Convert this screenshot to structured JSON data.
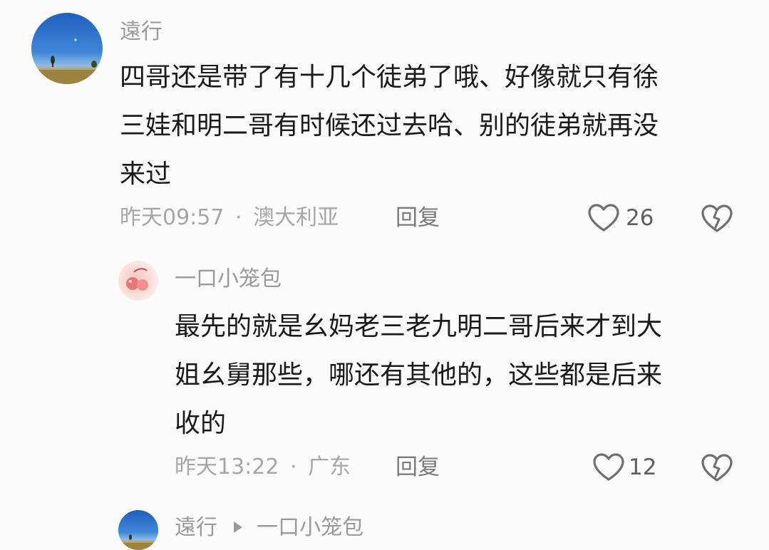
{
  "comments": [
    {
      "username": "遠行",
      "lines": [
        "四哥还是带了有十几个徒弟了哦、好像就只有徐",
        "三娃和明二哥有时候还过去哈、别的徒弟就再没",
        "来过"
      ],
      "time": "昨天09:57",
      "separator": "·",
      "location": "澳大利亚",
      "reply_label": "回复",
      "likes": "26",
      "avatar_icon": "landscape-avatar-icon"
    },
    {
      "username": "一口小笼包",
      "lines": [
        "最先的就是幺妈老三老九明二哥后来才到大",
        "姐幺舅那些，哪还有其他的，这些都是后来",
        "收的"
      ],
      "time": "昨天13:22",
      "separator": "·",
      "location": "广东",
      "reply_label": "回复",
      "likes": "12",
      "avatar_icon": "cherry-avatar-icon"
    },
    {
      "username": "遠行",
      "reply_to": "一口小笼包",
      "arrow_icon": "play-arrow-icon",
      "avatar_icon": "landscape-avatar-icon"
    }
  ],
  "icons": {
    "like": "heart-outline-icon",
    "dislike": "broken-heart-icon"
  },
  "colors": {
    "background": "#fbfbfb",
    "text": "#1a1a1a",
    "muted": "#a6a6a6",
    "icon": "#777777"
  }
}
